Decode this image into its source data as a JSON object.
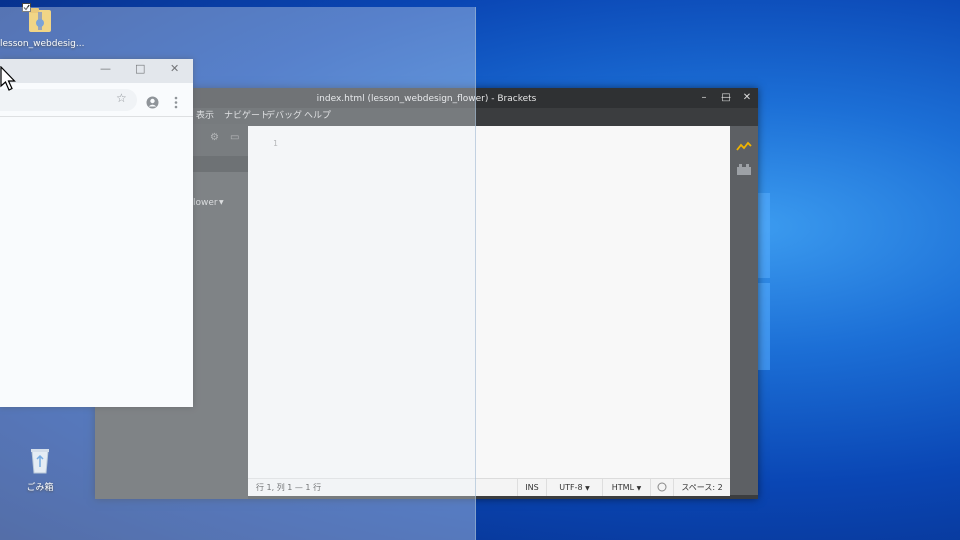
{
  "desktop": {
    "icons": [
      {
        "label": "lesson_webdesign_flower",
        "display": "lesson_webdesig...",
        "icon": "zip-folder-icon"
      },
      {
        "label": "ごみ箱",
        "icon": "recycle-bin-icon"
      }
    ],
    "accent": "#0a57c8"
  },
  "brackets": {
    "title": "index.html (lesson_webdesign_flower) - Brackets",
    "menu": [
      "表示",
      "ナビゲート",
      "デバッグ",
      "ヘルプ"
    ],
    "sidebar": {
      "project_name": "lower"
    },
    "editor": {
      "line_numbers": [
        "1"
      ]
    },
    "status": {
      "position": "行 1, 列 1 — 1 行",
      "mode": "INS",
      "encoding": "UTF-8",
      "language": "HTML",
      "indent": "スペース: 2"
    },
    "window_controls": [
      "minimize",
      "maximize",
      "close"
    ]
  },
  "chrome": {
    "window_controls": [
      "minimize",
      "maximize",
      "close"
    ],
    "icons": [
      "star-icon",
      "account-icon",
      "more-menu-icon"
    ]
  }
}
